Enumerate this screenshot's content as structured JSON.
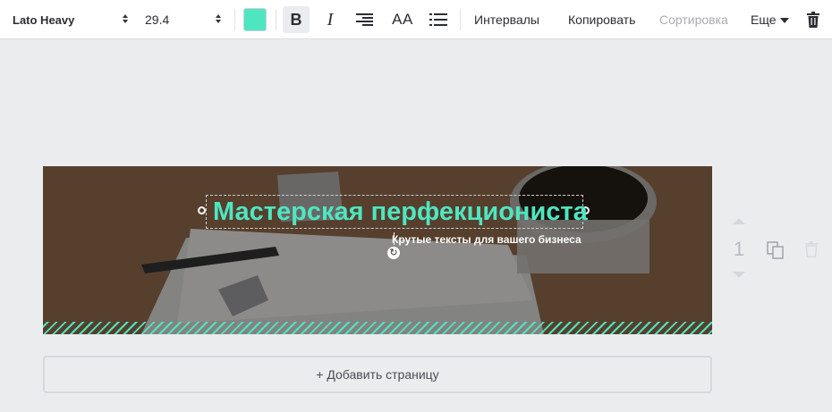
{
  "toolbar": {
    "font_name": "Lato Heavy",
    "font_size": "29.4",
    "text_color": "#4ee6c1",
    "bold_glyph": "B",
    "italic_glyph": "I",
    "case_glyph": "AA",
    "spacing_label": "Интервалы",
    "copy_label": "Копировать",
    "arrange_label": "Сортировка",
    "more_label": "Еще",
    "icons": [
      "bold-icon",
      "italic-icon",
      "align-right-icon",
      "letter-case-icon",
      "list-icon",
      "trash-icon"
    ]
  },
  "canvas": {
    "title": "Мастерская перфекциониста",
    "subtitle": "Крутые тексты для вашего бизнеса",
    "accent_color": "#4ee6c1"
  },
  "page_controls": {
    "page_number": "1"
  },
  "add_page_label": "+ Добавить страницу"
}
